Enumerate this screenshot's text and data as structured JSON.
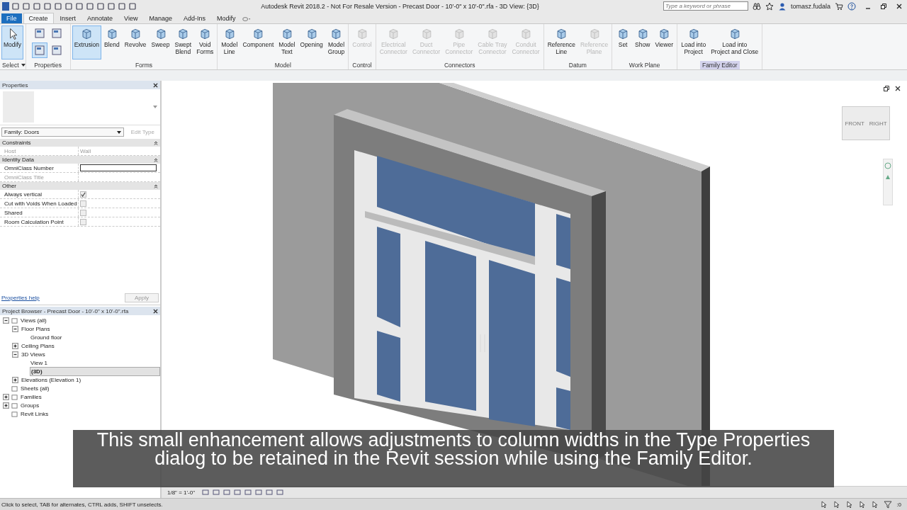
{
  "title_bar": {
    "title": "Autodesk Revit 2018.2 - Not For Resale Version -    Precast Door - 10'-0\" x 10'-0\".rfa - 3D View: {3D}",
    "search_placeholder": "Type a keyword or phrase",
    "user": "tomasz.fudala"
  },
  "tabs": [
    {
      "label": "File",
      "kind": "file",
      "selected": false
    },
    {
      "label": "Create",
      "kind": "tab",
      "selected": true
    },
    {
      "label": "Insert",
      "kind": "tab",
      "selected": false
    },
    {
      "label": "Annotate",
      "kind": "tab",
      "selected": false
    },
    {
      "label": "View",
      "kind": "tab",
      "selected": false
    },
    {
      "label": "Manage",
      "kind": "tab",
      "selected": false
    },
    {
      "label": "Add-Ins",
      "kind": "tab",
      "selected": false
    },
    {
      "label": "Modify",
      "kind": "tab",
      "selected": false
    }
  ],
  "ribbon": [
    {
      "label": "Select",
      "kind": "select",
      "highlighted": false,
      "buttons": [
        {
          "label": "Modify",
          "disabled": false,
          "active": true
        }
      ]
    },
    {
      "label": "Properties",
      "kind": "icons",
      "highlighted": false,
      "icon_buttons": [
        {
          "selected": false
        },
        {
          "selected": false
        },
        {
          "selected": true
        },
        {
          "selected": false
        }
      ]
    },
    {
      "label": "Forms",
      "kind": "buttons",
      "highlighted": false,
      "buttons": [
        {
          "label": "Extrusion",
          "disabled": false,
          "active": true
        },
        {
          "label": "Blend",
          "disabled": false,
          "active": false
        },
        {
          "label": "Revolve",
          "disabled": false,
          "active": false
        },
        {
          "label": "Sweep",
          "disabled": false,
          "active": false
        },
        {
          "label": "Swept\nBlend",
          "disabled": false,
          "active": false
        },
        {
          "label": "Void\nForms",
          "disabled": false,
          "active": false
        }
      ]
    },
    {
      "label": "Model",
      "kind": "buttons",
      "highlighted": false,
      "buttons": [
        {
          "label": "Model\nLine",
          "disabled": false,
          "active": false
        },
        {
          "label": "Component",
          "disabled": false,
          "active": false
        },
        {
          "label": "Model\nText",
          "disabled": false,
          "active": false
        },
        {
          "label": "Opening",
          "disabled": false,
          "active": false
        },
        {
          "label": "Model\nGroup",
          "disabled": false,
          "active": false
        }
      ]
    },
    {
      "label": "Control",
      "kind": "buttons",
      "highlighted": false,
      "buttons": [
        {
          "label": "Control",
          "disabled": true,
          "active": false
        }
      ]
    },
    {
      "label": "Connectors",
      "kind": "buttons",
      "highlighted": false,
      "buttons": [
        {
          "label": "Electrical\nConnector",
          "disabled": true,
          "active": false
        },
        {
          "label": "Duct\nConnector",
          "disabled": true,
          "active": false
        },
        {
          "label": "Pipe\nConnector",
          "disabled": true,
          "active": false
        },
        {
          "label": "Cable Tray\nConnector",
          "disabled": true,
          "active": false
        },
        {
          "label": "Conduit\nConnector",
          "disabled": true,
          "active": false
        }
      ]
    },
    {
      "label": "Datum",
      "kind": "buttons",
      "highlighted": false,
      "buttons": [
        {
          "label": "Reference\nLine",
          "disabled": false,
          "active": false
        },
        {
          "label": "Reference\nPlane",
          "disabled": true,
          "active": false
        }
      ]
    },
    {
      "label": "Work Plane",
      "kind": "buttons",
      "highlighted": false,
      "buttons": [
        {
          "label": "Set",
          "disabled": false,
          "active": false
        },
        {
          "label": "Show",
          "disabled": false,
          "active": false
        },
        {
          "label": "Viewer",
          "disabled": false,
          "active": false
        }
      ]
    },
    {
      "label": "Family Editor",
      "kind": "buttons",
      "highlighted": true,
      "buttons": [
        {
          "label": "Load into\nProject",
          "disabled": false,
          "active": false
        },
        {
          "label": "Load into\nProject and Close",
          "disabled": false,
          "active": false
        }
      ]
    }
  ],
  "properties": {
    "title": "Properties",
    "type_selector": "Family: Doors",
    "edit_type": "Edit Type",
    "groups": [
      {
        "name": "Constraints",
        "rows": [
          {
            "name": "Host",
            "kind": "text",
            "value": "Wall",
            "disabled": true
          }
        ]
      },
      {
        "name": "Identity Data",
        "rows": [
          {
            "name": "OmniClass Number",
            "kind": "field",
            "disabled": false
          },
          {
            "name": "OmniClass Title",
            "kind": "text",
            "disabled": true
          }
        ]
      },
      {
        "name": "Other",
        "rows": [
          {
            "name": "Always vertical",
            "kind": "checkbox",
            "checked": true,
            "disabled": false
          },
          {
            "name": "Cut with Voids When Loaded",
            "kind": "checkbox",
            "checked": false,
            "disabled": false
          },
          {
            "name": "Shared",
            "kind": "checkbox",
            "checked": false,
            "disabled": false
          },
          {
            "name": "Room Calculation Point",
            "kind": "checkbox",
            "checked": false,
            "disabled": false
          }
        ]
      }
    ],
    "help_link": "Properties help",
    "apply": "Apply"
  },
  "project_browser": {
    "title": "Project Browser - Precast Door - 10'-0\" x 10'-0\".rfa",
    "tree": [
      {
        "label": "Views (all)",
        "expanded": true,
        "selected": false,
        "children": [
          {
            "label": "Floor Plans",
            "expanded": true,
            "selected": false,
            "children": [
              {
                "label": "Ground floor",
                "selected": false
              }
            ]
          },
          {
            "label": "Ceiling Plans",
            "expanded": false,
            "selected": false
          },
          {
            "label": "3D Views",
            "expanded": true,
            "selected": false,
            "children": [
              {
                "label": "View 1",
                "selected": false
              },
              {
                "label": "(3D)",
                "selected": true
              }
            ]
          },
          {
            "label": "Elevations (Elevation 1)",
            "expanded": false,
            "selected": false
          }
        ]
      },
      {
        "label": "Sheets (all)",
        "selected": false
      },
      {
        "label": "Families",
        "expanded": false,
        "selected": false
      },
      {
        "label": "Groups",
        "expanded": false,
        "selected": false
      },
      {
        "label": "Revit Links",
        "selected": false
      }
    ]
  },
  "view_cube": {
    "front": "FRONT",
    "right": "RIGHT"
  },
  "view_control_bar": {
    "scale": "1/8\" = 1'-0\""
  },
  "caption": "This small enhancement allows adjustments to column widths in the Type Properties dialog to be retained in the Revit session while using the Family Editor.",
  "status_bar": {
    "message": "Click to select, TAB for alternates, CTRL adds, SHIFT unselects.",
    "filter_count": ":0"
  }
}
